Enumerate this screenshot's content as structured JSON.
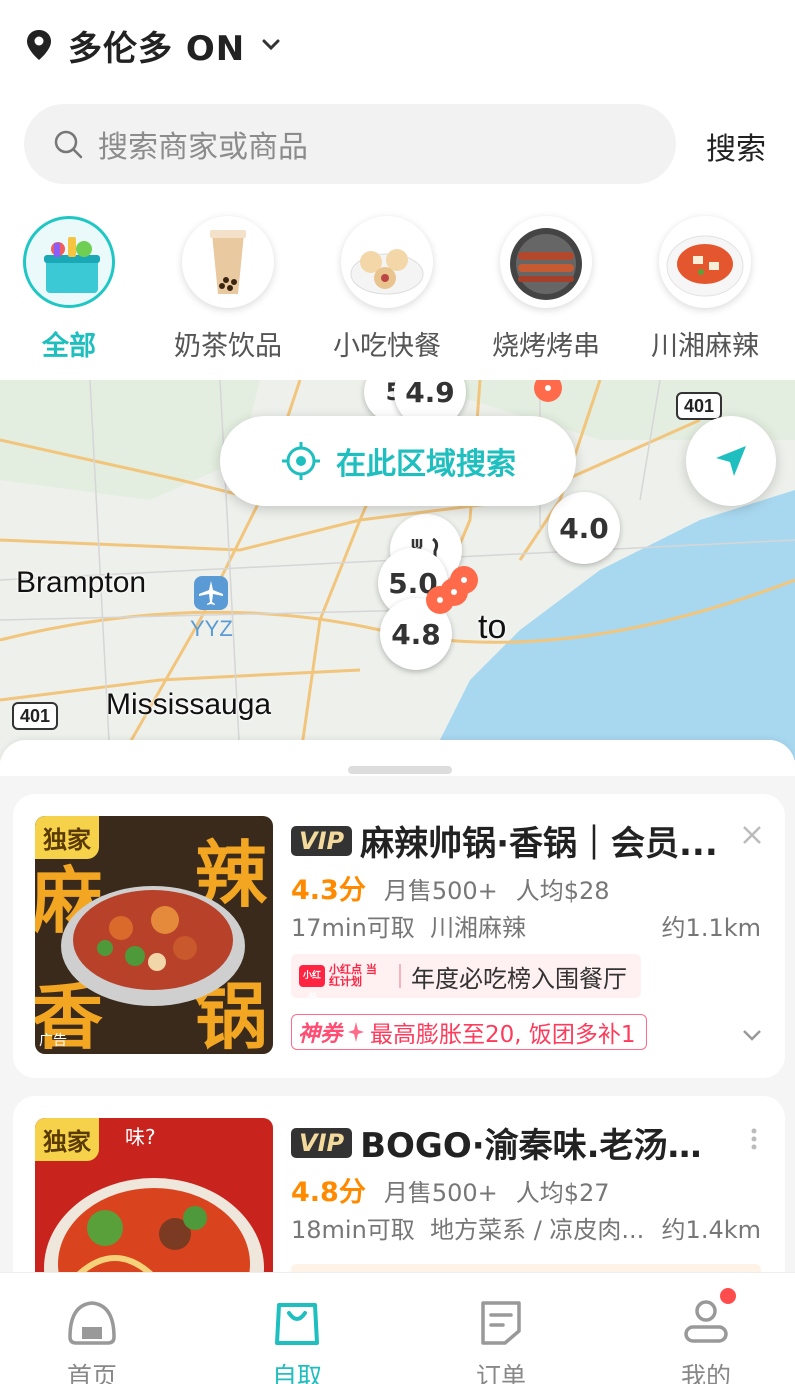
{
  "header": {
    "location": "多伦多 ON",
    "search_placeholder": "搜索商家或商品",
    "search_button": "搜索"
  },
  "categories": [
    {
      "label": "全部",
      "icon": "grocery-basket-icon",
      "active": true
    },
    {
      "label": "奶茶饮品",
      "icon": "bubble-tea-icon",
      "active": false
    },
    {
      "label": "小吃快餐",
      "icon": "dumplings-icon",
      "active": false
    },
    {
      "label": "烧烤烤串",
      "icon": "bbq-skewer-icon",
      "active": false
    },
    {
      "label": "川湘麻辣",
      "icon": "spicy-dish-icon",
      "active": false
    }
  ],
  "map": {
    "area_search_button": "在此区域搜索",
    "cities": [
      "Brampton",
      "Mississauga",
      "to"
    ],
    "airport": "YYZ",
    "highways": [
      "401",
      "401"
    ],
    "ratings": [
      "4.9",
      "4.0",
      "4.8",
      "5",
      "5.0"
    ]
  },
  "list": [
    {
      "exclusive": "独家",
      "ad": "广告",
      "vip": "VIP",
      "name": "麻辣帅锅·香锅｜会员...",
      "score": "4.3分",
      "monthly": "月售500+",
      "avg": "人均$28",
      "pickup": "17min可取",
      "cuisine": "川湘麻辣",
      "distance": "约1.1km",
      "badge_brand": "小红书",
      "badge_brand_sub": "小红点 当红计划",
      "badge_text": "年度必吃榜入围餐厅",
      "coupon_tag": "神券",
      "coupon_text": "最高膨胀至20, 饭团多补1"
    },
    {
      "exclusive": "独家",
      "vip": "VIP",
      "name": "BOGO·渝秦味.老汤家...",
      "score": "4.8分",
      "monthly": "月售500+",
      "avg": "人均$27",
      "pickup": "18min可取",
      "cuisine": "地方菜系 / 凉皮肉...",
      "distance": "约1.4km"
    }
  ],
  "tabbar": [
    {
      "label": "首页",
      "icon": "home-icon",
      "active": false
    },
    {
      "label": "自取",
      "icon": "bag-icon",
      "active": true
    },
    {
      "label": "订单",
      "icon": "order-icon",
      "active": false
    },
    {
      "label": "我的",
      "icon": "profile-icon",
      "active": false
    }
  ],
  "colors": {
    "accent": "#1fbfbf",
    "score": "#ff8a00",
    "coupon": "#ff3b5c"
  }
}
